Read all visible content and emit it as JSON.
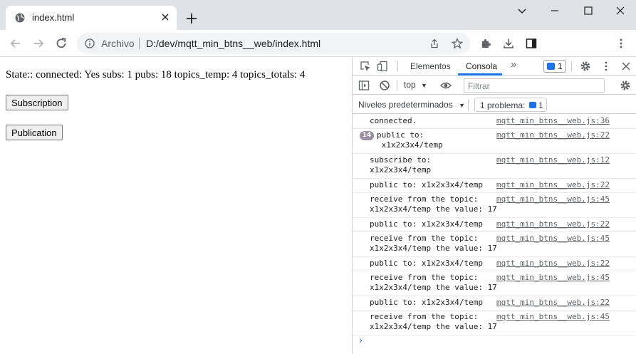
{
  "browser": {
    "tab_title": "index.html",
    "address_scheme": "Archivo",
    "address_url": "D:/dev/mqtt_min_btns__web/index.html"
  },
  "page": {
    "state_text": "State:: connected: Yes subs: 1 pubs: 18 topics_temp: 4 topics_totals: 4",
    "subscription_label": "Subscription",
    "publication_label": "Publication"
  },
  "devtools": {
    "tabs": [
      "Elementos",
      "Consola"
    ],
    "active_tab": "Consola",
    "issue_count": "1",
    "context": "top",
    "filter_placeholder": "Filtrar",
    "levels_label": "Niveles predeterminados",
    "issues_label": "1 problema:",
    "issues_count": "1",
    "messages": [
      {
        "text": "connected.",
        "source": "mqtt_min_btns__web.js:36"
      },
      {
        "count": "14",
        "text": "public to:\n x1x2x3x4/temp",
        "source": "mqtt_min_btns__web.js:22"
      },
      {
        "text": "subscribe to:\nx1x2x3x4/temp",
        "source": "mqtt_min_btns__web.js:12"
      },
      {
        "text": "public to: x1x2x3x4/temp",
        "source": "mqtt_min_btns__web.js:22"
      },
      {
        "text": "receive from the topic:\nx1x2x3x4/temp the value: 17",
        "source": "mqtt_min_btns__web.js:45"
      },
      {
        "text": "public to: x1x2x3x4/temp",
        "source": "mqtt_min_btns__web.js:22"
      },
      {
        "text": "receive from the topic:\nx1x2x3x4/temp the value: 17",
        "source": "mqtt_min_btns__web.js:45"
      },
      {
        "text": "public to: x1x2x3x4/temp",
        "source": "mqtt_min_btns__web.js:22"
      },
      {
        "text": "receive from the topic:\nx1x2x3x4/temp the value: 17",
        "source": "mqtt_min_btns__web.js:45"
      },
      {
        "text": "public to: x1x2x3x4/temp",
        "source": "mqtt_min_btns__web.js:22"
      },
      {
        "text": "receive from the topic:\nx1x2x3x4/temp the value: 17",
        "source": "mqtt_min_btns__web.js:45"
      }
    ],
    "prompt_symbol": "›"
  },
  "colors": {
    "accent": "#1a73e8",
    "tabstrip": "#dee1e6",
    "count_badge": "#9b8ea0"
  }
}
